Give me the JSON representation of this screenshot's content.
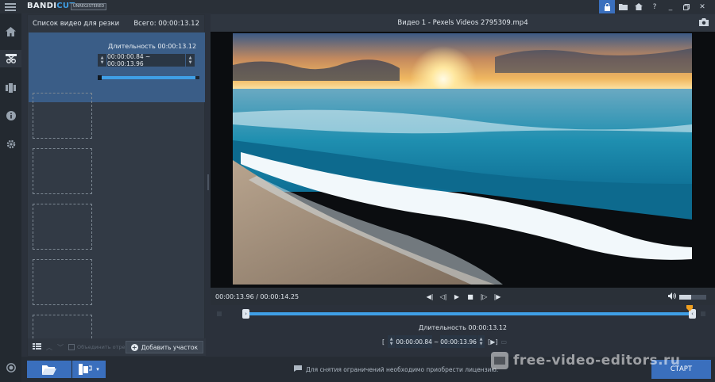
{
  "app": {
    "logo_primary": "BANDI",
    "logo_accent": "CUT",
    "registration_badge": "UNREGISTERED"
  },
  "titlebar": {
    "icons": [
      "lock-icon",
      "folder-icon",
      "home-icon",
      "help-icon",
      "minimize-icon",
      "restore-icon",
      "close-icon"
    ]
  },
  "rail": {
    "items": [
      "home-icon",
      "cut-icon",
      "encode-icon",
      "info-icon",
      "settings-icon"
    ],
    "active": "cut-icon",
    "bottom_icon": "record-icon"
  },
  "clip_list": {
    "title": "Список видео для резки",
    "total": "Всего: 00:00:13.12",
    "active_clip": {
      "duration": "Длительность 00:00:13.12",
      "range": "00:00:00.84 ~ 00:00:13.96",
      "progress": 0.96
    },
    "empty_slots": 5,
    "footer": {
      "merge_label": "Объединить отрезки",
      "add_button": "Добавить участок"
    }
  },
  "video": {
    "title": "Видео 1 - Pexels Videos 2795309.mp4",
    "timecode": "00:00:13.96 / 00:00:14.25",
    "volume": 0.45,
    "selection_start": 0.0,
    "selection_end": 0.98,
    "segment_duration": "Длительность 00:00:13.12",
    "segment_start": "00:00:00.84",
    "segment_end": "00:00:13.96",
    "segment_separator": "~"
  },
  "bottom": {
    "notice": "Для снятия ограничений необходимо приобрести лицензию.",
    "start_button": "СТАРТ",
    "watermark": "free-video-editors.ru"
  },
  "colors": {
    "accent": "#3f9fe6",
    "button": "#3a6fbd",
    "active_clip": "#3a5d87",
    "marker": "#f0a020"
  }
}
